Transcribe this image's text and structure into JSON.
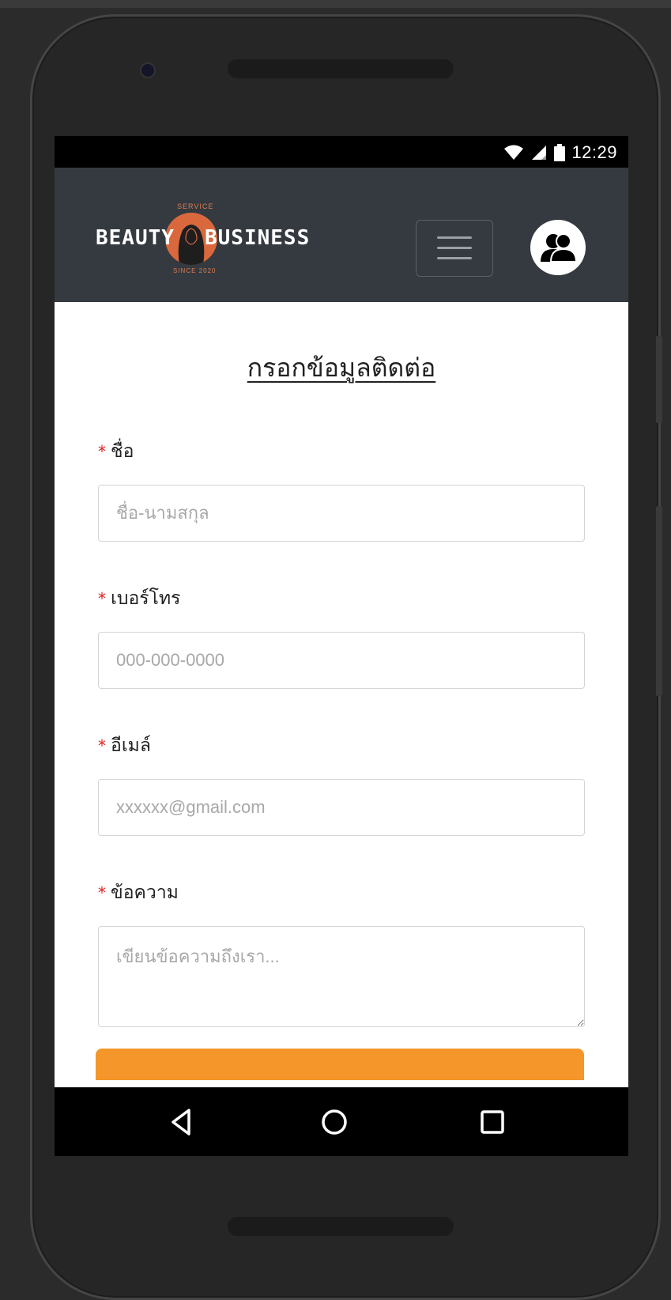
{
  "status_bar": {
    "time": "12:29"
  },
  "navbar": {
    "brand_left": "BEAUTY",
    "brand_right": "BUSINESS",
    "brand_top": "SERVICE",
    "brand_bottom": "SINCE 2020"
  },
  "form": {
    "title": "กรอกข้อมูลติดต่อ",
    "required_marker": "*",
    "fields": [
      {
        "label": "ชื่อ",
        "placeholder": "ชื่อ-นามสกุล"
      },
      {
        "label": "เบอร์โทร",
        "placeholder": "000-000-0000"
      },
      {
        "label": "อีเมล์",
        "placeholder": "xxxxxx@gmail.com"
      },
      {
        "label": "ข้อความ",
        "placeholder": "เขียนข้อความถึงเรา..."
      }
    ]
  },
  "colors": {
    "navbar_bg": "#343a40",
    "submit_bg": "#f4962a",
    "required": "#e02020",
    "logo_accent": "#d9693d"
  },
  "icons": {
    "status": [
      "wifi-icon",
      "signal-icon",
      "battery-icon"
    ],
    "navbar": [
      "hamburger-menu-icon",
      "users-icon"
    ],
    "system_nav": [
      "back-icon",
      "home-icon",
      "recents-icon"
    ]
  }
}
